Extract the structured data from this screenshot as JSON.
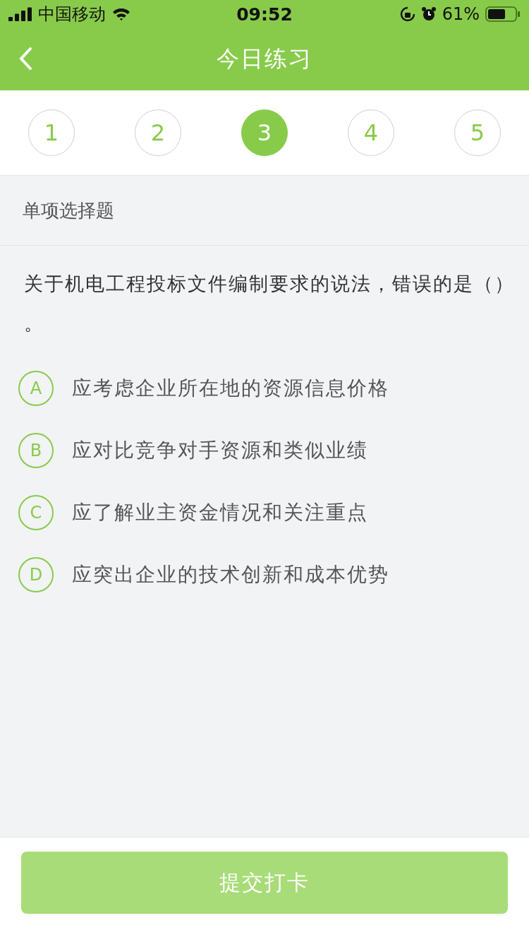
{
  "status_bar": {
    "carrier": "中国移动",
    "time": "09:52",
    "battery": "61%"
  },
  "nav": {
    "title": "今日练习"
  },
  "steps": [
    {
      "label": "1",
      "selected": false
    },
    {
      "label": "2",
      "selected": false
    },
    {
      "label": "3",
      "selected": true
    },
    {
      "label": "4",
      "selected": false
    },
    {
      "label": "5",
      "selected": false
    }
  ],
  "question_type": "单项选择题",
  "question": "关于机电工程投标文件编制要求的说法，错误的是（）。",
  "options": [
    {
      "letter": "A",
      "text": "应考虑企业所在地的资源信息价格",
      "selected": false
    },
    {
      "letter": "B",
      "text": "应对比竞争对手资源和类似业绩",
      "selected": false
    },
    {
      "letter": "C",
      "text": "应了解业主资金情况和关注重点",
      "selected": false
    },
    {
      "letter": "D",
      "text": "应突出企业的技术创新和成本优势",
      "selected": false
    }
  ],
  "submit": {
    "label": "提交打卡",
    "disabled": true
  }
}
